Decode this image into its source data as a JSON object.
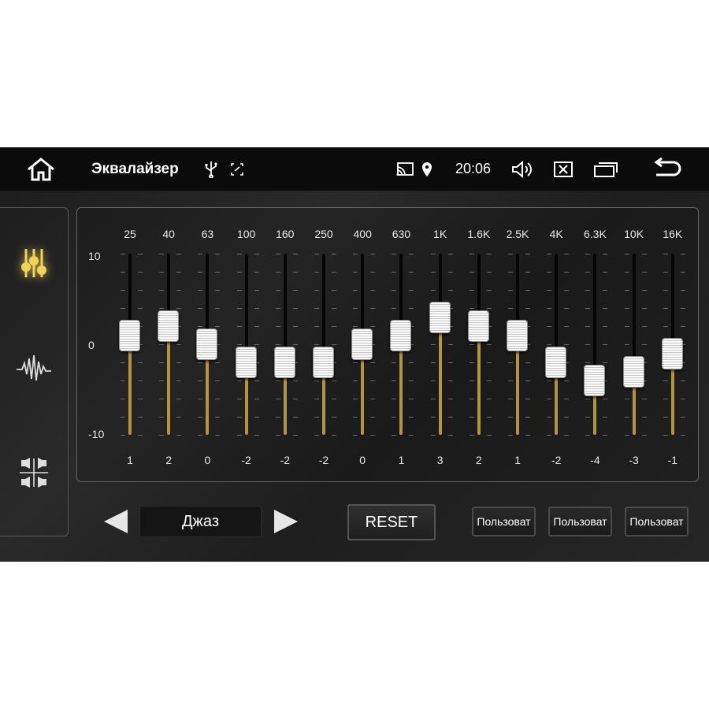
{
  "status_bar": {
    "title": "Эквалайзер",
    "time": "20:06",
    "icons": [
      "home-icon",
      "usb-icon",
      "screenshot-icon",
      "cast-icon",
      "location-icon",
      "volume-icon",
      "close-app-icon",
      "recent-apps-icon",
      "back-icon"
    ]
  },
  "sidebar": {
    "items": [
      {
        "icon": "equalizer-sliders-icon",
        "active": true
      },
      {
        "icon": "sound-wave-icon",
        "active": false
      },
      {
        "icon": "speaker-balance-icon",
        "active": false
      }
    ],
    "active_color": "#f2d35a"
  },
  "equalizer": {
    "axis_labels": {
      "max": "10",
      "mid": "0",
      "min": "-10"
    },
    "range": [
      -10,
      10
    ],
    "fill_color": "#b8933f",
    "bands": [
      {
        "freq": "25",
        "value": 1
      },
      {
        "freq": "40",
        "value": 2
      },
      {
        "freq": "63",
        "value": 0
      },
      {
        "freq": "100",
        "value": -2
      },
      {
        "freq": "160",
        "value": -2
      },
      {
        "freq": "250",
        "value": -2
      },
      {
        "freq": "400",
        "value": 0
      },
      {
        "freq": "630",
        "value": 1
      },
      {
        "freq": "1K",
        "value": 3
      },
      {
        "freq": "1.6K",
        "value": 2
      },
      {
        "freq": "2.5K",
        "value": 1
      },
      {
        "freq": "4K",
        "value": -2
      },
      {
        "freq": "6.3K",
        "value": -4
      },
      {
        "freq": "10K",
        "value": -3
      },
      {
        "freq": "16K",
        "value": -1
      }
    ]
  },
  "controls": {
    "preset_name": "Джаз",
    "reset_label": "RESET",
    "user_presets": [
      "Пользоват",
      "Пользоват",
      "Пользоват"
    ]
  }
}
